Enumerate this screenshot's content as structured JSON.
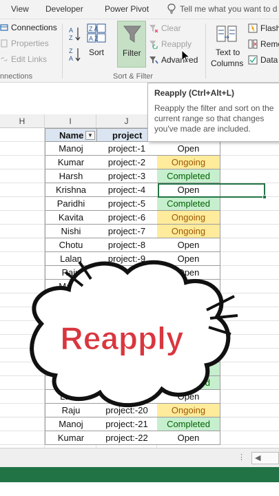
{
  "tabs": [
    "View",
    "Developer",
    "Power Pivot"
  ],
  "tell_me": "Tell me what you want to d",
  "ribbon": {
    "connections": "Connections",
    "properties": "Properties",
    "edit_links": "Edit Links",
    "connections_group": "nnections",
    "sort": "Sort",
    "sort_za": "Z A",
    "sort_az": "A Z",
    "filter": "Filter",
    "clear": "Clear",
    "reapply": "Reapply",
    "advanced": "Advanced",
    "sort_filter_group": "Sort & Filter",
    "text_to_columns_1": "Text to",
    "text_to_columns_2": "Columns",
    "flash": "Flash",
    "remove": "Remo",
    "data": "Data"
  },
  "tooltip": {
    "title": "Reapply (Ctrl+Alt+L)",
    "body": "Reapply the filter and sort on the current range so that changes you've made are included."
  },
  "columns": [
    "H",
    "I",
    "J"
  ],
  "table": {
    "headers": [
      "Name",
      "project"
    ],
    "rows": [
      {
        "name": "Manoj",
        "project": "project:-1",
        "status": "Open"
      },
      {
        "name": "Kumar",
        "project": "project:-2",
        "status": "Ongoing"
      },
      {
        "name": "Harsh",
        "project": "project:-3",
        "status": "Completed"
      },
      {
        "name": "Krishna",
        "project": "project:-4",
        "status": "Open"
      },
      {
        "name": "Paridhi",
        "project": "project:-5",
        "status": "Completed"
      },
      {
        "name": "Kavita",
        "project": "project:-6",
        "status": "Ongoing"
      },
      {
        "name": "Nishi",
        "project": "project:-7",
        "status": "Ongoing"
      },
      {
        "name": "Chotu",
        "project": "project:-8",
        "status": "Open"
      },
      {
        "name": "Lalan",
        "project": "project:-9",
        "status": "Open"
      },
      {
        "name": "Raju",
        "project": "project:-10",
        "status": "Open"
      },
      {
        "name": "Manoj",
        "project": "project:-11",
        "status": "Open"
      },
      {
        "name": "",
        "project": "",
        "status": "Completed"
      },
      {
        "name": "",
        "project": "",
        "status": "Completed"
      },
      {
        "name": "",
        "project": "",
        "status": ""
      },
      {
        "name": "",
        "project": "",
        "status": ""
      },
      {
        "name": "",
        "project": "",
        "status": ""
      },
      {
        "name": "",
        "project": "",
        "status": "Completed"
      },
      {
        "name": "",
        "project": "",
        "status": "Completed"
      },
      {
        "name": "Lalan",
        "project": "project:-19",
        "status": "Open"
      },
      {
        "name": "Raju",
        "project": "project:-20",
        "status": "Ongoing"
      },
      {
        "name": "Manoj",
        "project": "project:-21",
        "status": "Completed"
      },
      {
        "name": "Kumar",
        "project": "project:-22",
        "status": "Open"
      }
    ]
  },
  "overlay_text": "Reapply",
  "colors": {
    "excel_green": "#217346",
    "ongoing_fill": "#ffeb9c",
    "completed_fill": "#c6efce",
    "header_fill": "#dbe5f1",
    "overlay_red": "#d9363e"
  }
}
